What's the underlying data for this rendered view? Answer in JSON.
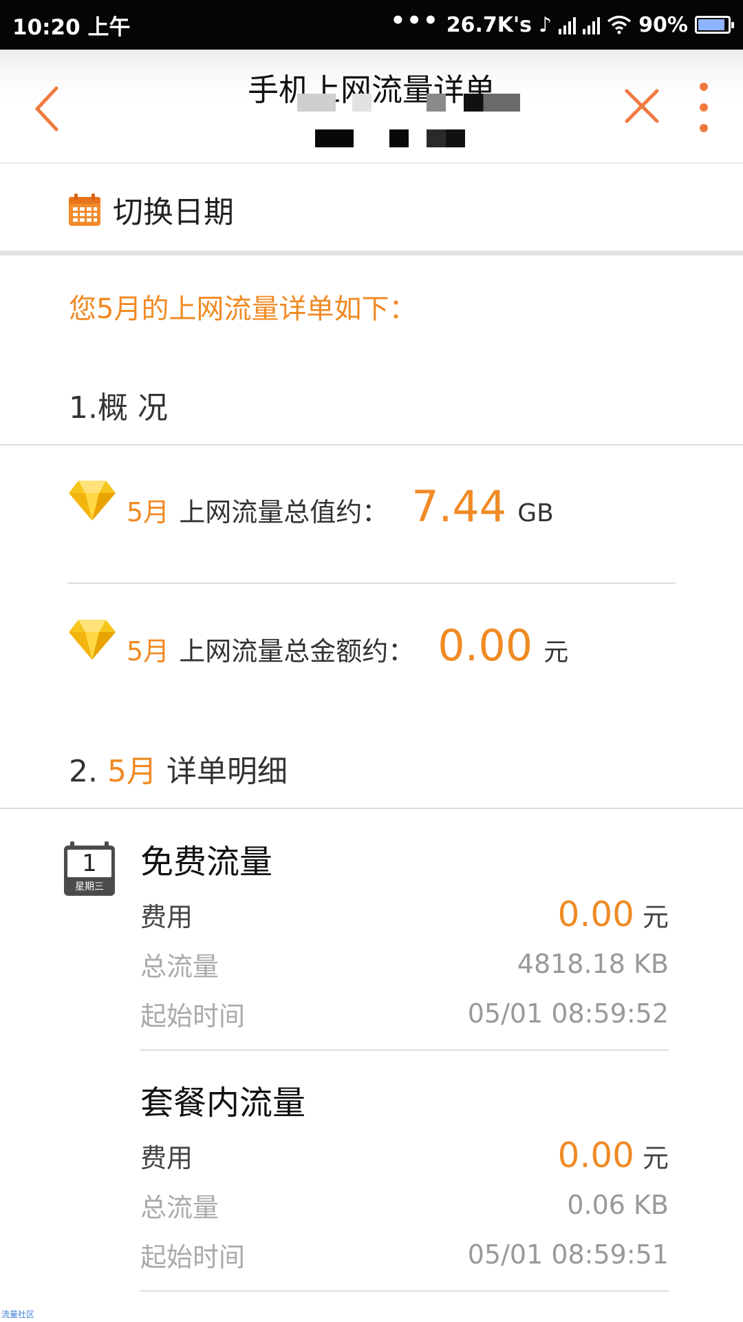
{
  "status_bar": {
    "time": "10:20 上午",
    "speed": "26.7K's",
    "battery": "90%",
    "battery_level": 0.9
  },
  "header": {
    "title": "手机上网流量详单"
  },
  "switch_date": {
    "label": "切换日期"
  },
  "intro": "您5月的上网流量详单如下：",
  "overview": {
    "heading": "1.概 况",
    "rows": [
      {
        "month": "5月",
        "label": "上网流量总值约：",
        "value": "7.44",
        "unit": "GB"
      },
      {
        "month": "5月",
        "label": "上网流量总金额约：",
        "value": "0.00",
        "unit": "元"
      }
    ]
  },
  "detail": {
    "heading_prefix": "2.",
    "heading_month": "5月",
    "heading_suffix": "详单明细",
    "day_icon": {
      "day": "1",
      "weekday": "星期三"
    },
    "items": [
      {
        "name": "免费流量",
        "fee_label": "费用",
        "fee": "0.00",
        "fee_unit": "元",
        "traffic_label": "总流量",
        "traffic": "4818.18 KB",
        "start_label": "起始时间",
        "start": "05/01 08:59:52"
      },
      {
        "name": "套餐内流量",
        "fee_label": "费用",
        "fee": "0.00",
        "fee_unit": "元",
        "traffic_label": "总流量",
        "traffic": "0.06 KB",
        "start_label": "起始时间",
        "start": "05/01 08:59:51"
      }
    ]
  },
  "watermark": "流量社区",
  "colors": {
    "accent": "#f08a24",
    "icon_orange": "#f07a3e"
  }
}
